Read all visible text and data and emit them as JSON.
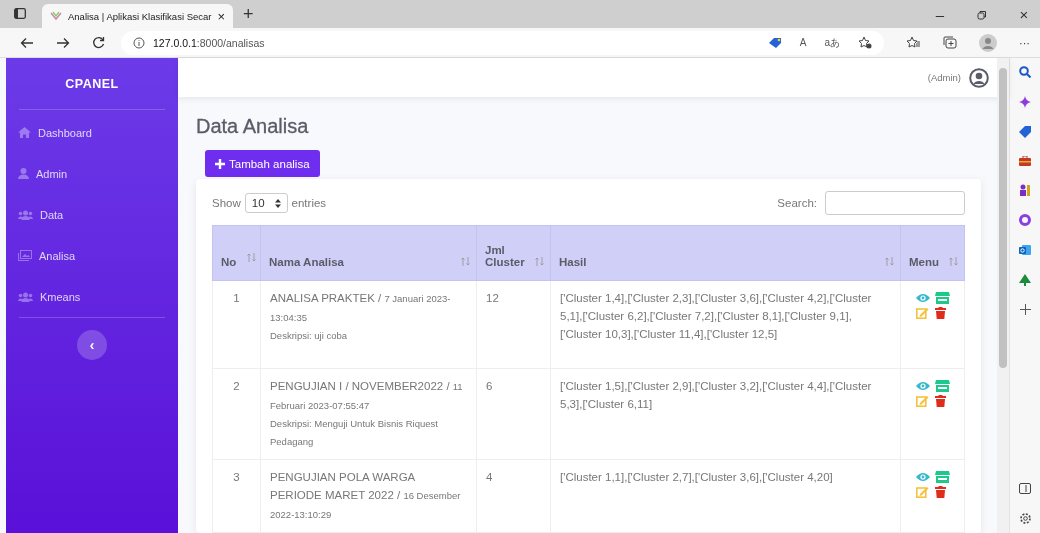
{
  "browser": {
    "tab_title": "Analisa | Aplikasi Klasifikasi Secar",
    "tab_close": "×",
    "new_tab": "+",
    "url_host": "127.0.0.1",
    "url_path": ":8000/analisas",
    "read_aloud": "A",
    "translate": "aあ",
    "more": "···",
    "minimize": "–",
    "close": "×"
  },
  "sidebar": {
    "brand": "CPANEL",
    "items": [
      {
        "label": "Dashboard",
        "kind": "home",
        "selected": false
      },
      {
        "label": "Admin",
        "kind": "user",
        "selected": false
      },
      {
        "label": "Data",
        "kind": "users",
        "selected": false
      },
      {
        "label": "Analisa",
        "kind": "image",
        "selected": false
      },
      {
        "label": "Kmeans",
        "kind": "users",
        "selected": false
      }
    ],
    "toggle": "‹"
  },
  "topbar": {
    "user": "(Admin)"
  },
  "page": {
    "title": "Data Analisa",
    "add_button": "Tambah analisa"
  },
  "table_controls": {
    "show": "Show",
    "entries_value": "10",
    "entries": "entries",
    "search": "Search:"
  },
  "table": {
    "columns": [
      "No",
      "Nama Analisa",
      "Jml Cluster",
      "Hasil",
      "Menu"
    ],
    "rows": [
      {
        "no": "1",
        "name": "ANALISA PRAKTEK / ",
        "date": "7 Januari 2023-13:04:35",
        "description": "Deskripsi: uji coba",
        "clusters": "12",
        "result": "['Cluster 1,4],['Cluster 2,3],['Cluster 3,6],['Cluster 4,2],['Cluster 5,1],['Cluster 6,2],['Cluster 7,2],['Cluster 8,1],['Cluster 9,1],['Cluster 10,3],['Cluster 11,4],['Cluster 12,5]"
      },
      {
        "no": "2",
        "name": "PENGUJIAN I / NOVEMBER2022 / ",
        "date": "11 Februari 2023-07:55:47",
        "description": "Deskripsi: Menguji Untuk Bisnis Riquest Pedagang",
        "clusters": "6",
        "result": "['Cluster 1,5],['Cluster 2,9],['Cluster 3,2],['Cluster 4,4],['Cluster 5,3],['Cluster 6,11]"
      },
      {
        "no": "3",
        "name": "PENGUJIAN POLA WARGA PERIODE MARET 2022 / ",
        "date": "16 Desember 2022-13:10:29",
        "clusters": "4",
        "result": "['Cluster 1,1],['Cluster 2,7],['Cluster 3,6],['Cluster 4,20]"
      }
    ]
  }
}
